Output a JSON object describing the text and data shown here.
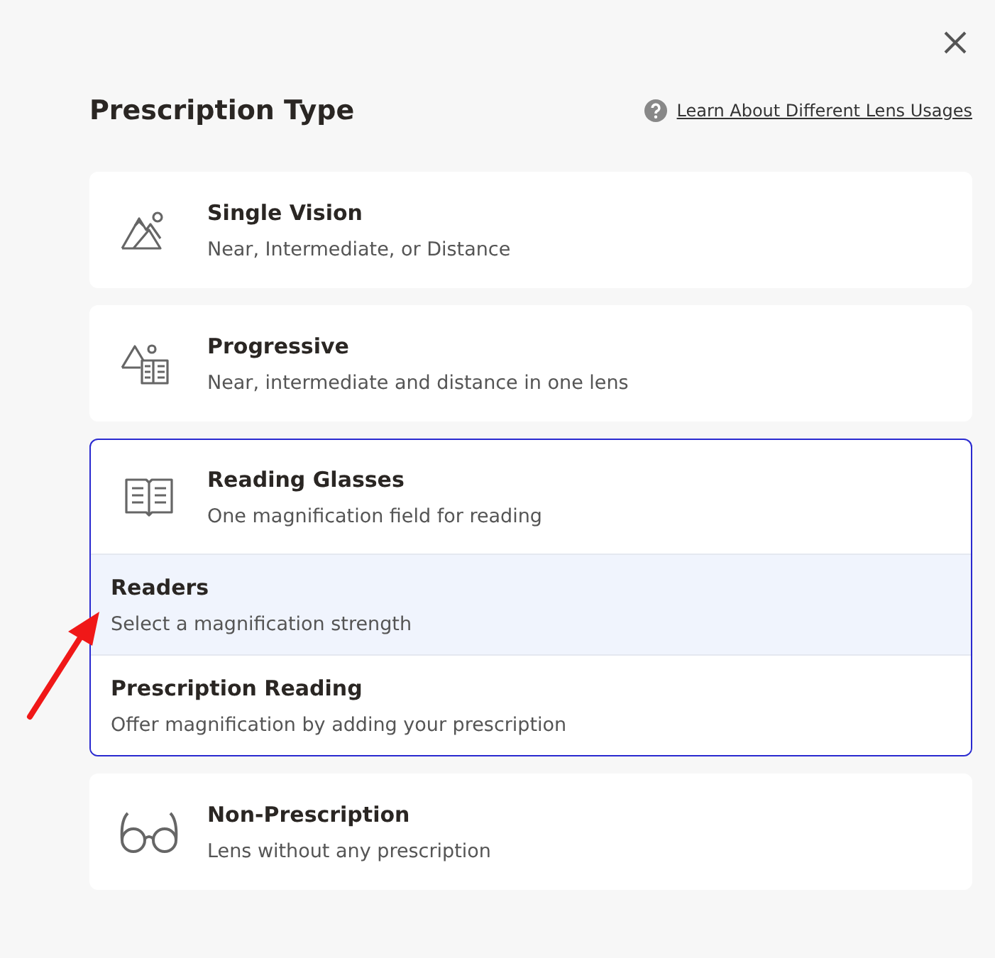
{
  "header": {
    "title": "Prescription Type",
    "help_link": "Learn About Different Lens Usages"
  },
  "options": [
    {
      "kind": "mountains",
      "title": "Single Vision",
      "subtitle": "Near, Intermediate, or Distance",
      "expanded": false
    },
    {
      "kind": "mountains-book",
      "title": "Progressive",
      "subtitle": "Near, intermediate and distance in one lens",
      "expanded": false
    },
    {
      "kind": "book",
      "title": "Reading Glasses",
      "subtitle": "One magnification field for reading",
      "expanded": true,
      "sub_options": [
        {
          "title": "Readers",
          "subtitle": "Select a magnification strength",
          "selected": true
        },
        {
          "title": "Prescription Reading",
          "subtitle": "Offer magnification by adding your prescription",
          "selected": false
        }
      ]
    },
    {
      "kind": "glasses",
      "title": "Non-Prescription",
      "subtitle": "Lens without any prescription",
      "expanded": false
    }
  ],
  "annotation": {
    "kind": "arrow"
  }
}
